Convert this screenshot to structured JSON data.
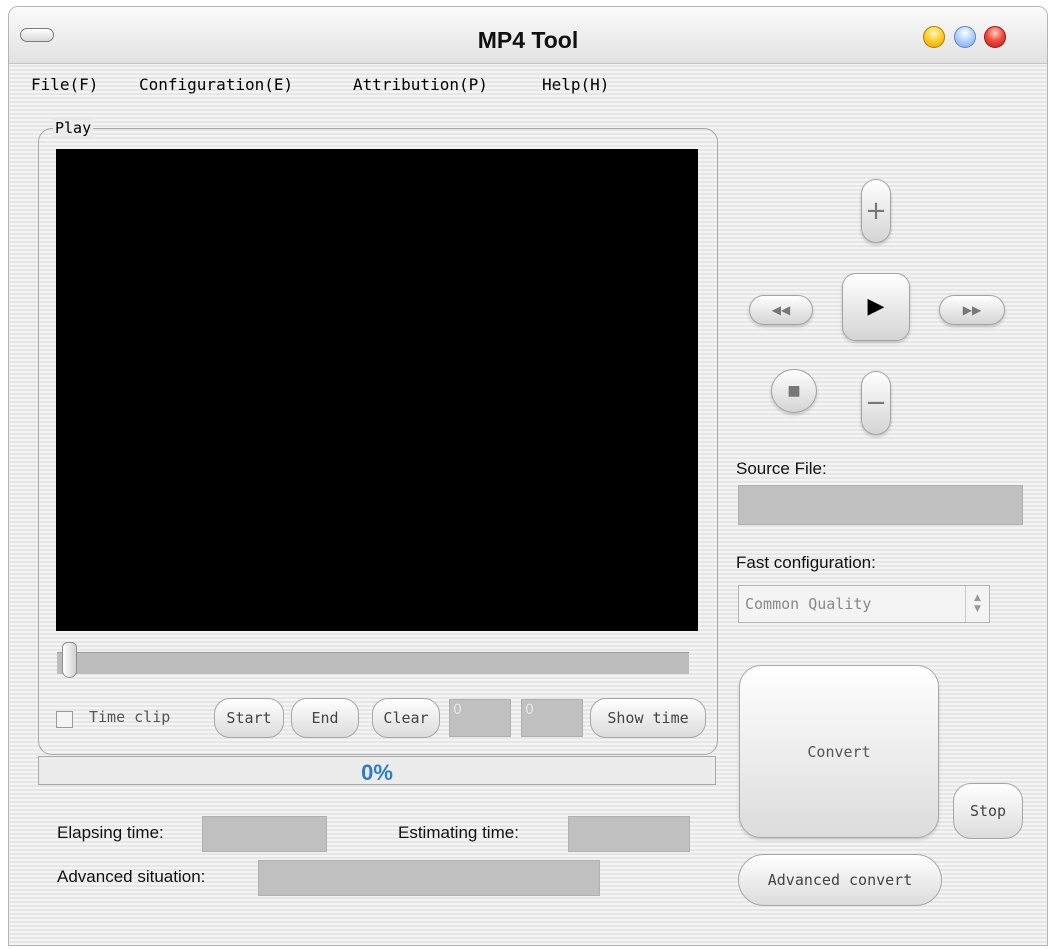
{
  "window": {
    "title": "MP4 Tool"
  },
  "menu": {
    "file": "File(F)",
    "configuration": "Configuration(E)",
    "attribution": "Attribution(P)",
    "help": "Help(H)"
  },
  "play": {
    "legend": "Play",
    "seek_position": 0,
    "time_clip_label": "Time clip",
    "time_clip_checked": false,
    "start_label": "Start",
    "end_label": "End",
    "clear_label": "Clear",
    "start_value": "0",
    "end_value": "0",
    "show_time_label": "Show time"
  },
  "progress": {
    "text": "0%",
    "value": 0
  },
  "status": {
    "elapsing_label": "Elapsing time:",
    "elapsing_value": "",
    "estimating_label": "Estimating time:",
    "estimating_value": "",
    "advanced_label": "Advanced situation:",
    "advanced_value": ""
  },
  "controls": {
    "volume_up_icon": "plus-icon",
    "volume_down_icon": "minus-icon",
    "rewind_icon": "rewind-icon",
    "play_icon": "play-icon",
    "forward_icon": "fast-forward-icon",
    "stop_icon": "stop-icon"
  },
  "source": {
    "label": "Source File:",
    "value": ""
  },
  "fast_config": {
    "label": "Fast configuration:",
    "selected": "Common Quality"
  },
  "actions": {
    "convert": "Convert",
    "stop": "Stop",
    "advanced_convert": "Advanced convert"
  },
  "colors": {
    "progress_text": "#2e7bc8",
    "video_background": "#000000",
    "field_gray": "#c0c0c0"
  }
}
